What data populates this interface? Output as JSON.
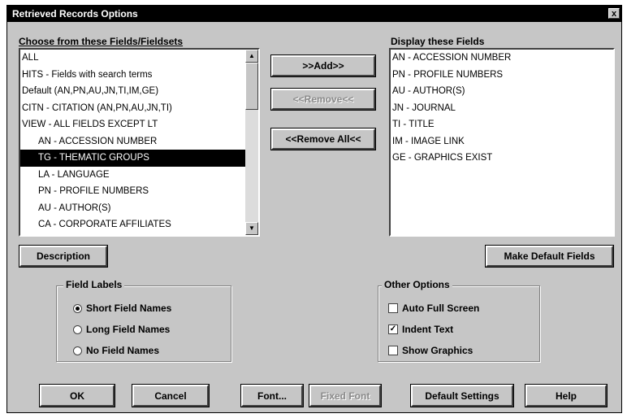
{
  "window": {
    "title": "Retrieved Records Options",
    "close_glyph": "x"
  },
  "choose": {
    "label": "Choose from these Fields/Fieldsets",
    "items": [
      {
        "text": "ALL",
        "indent": false,
        "selected": false
      },
      {
        "text": "HITS - Fields with search terms",
        "indent": false,
        "selected": false
      },
      {
        "text": "Default (AN,PN,AU,JN,TI,IM,GE)",
        "indent": false,
        "selected": false
      },
      {
        "text": "CITN - CITATION (AN,PN,AU,JN,TI)",
        "indent": false,
        "selected": false
      },
      {
        "text": "VIEW - ALL FIELDS EXCEPT LT",
        "indent": false,
        "selected": false
      },
      {
        "text": "AN - ACCESSION NUMBER",
        "indent": true,
        "selected": false
      },
      {
        "text": "TG - THEMATIC GROUPS",
        "indent": true,
        "selected": true
      },
      {
        "text": "LA - LANGUAGE",
        "indent": true,
        "selected": false
      },
      {
        "text": "PN - PROFILE NUMBERS",
        "indent": true,
        "selected": false
      },
      {
        "text": "AU - AUTHOR(S)",
        "indent": true,
        "selected": false
      },
      {
        "text": "CA - CORPORATE AFFILIATES",
        "indent": true,
        "selected": false
      }
    ]
  },
  "display": {
    "label": "Display these Fields",
    "items": [
      "AN - ACCESSION NUMBER",
      "PN - PROFILE NUMBERS",
      "AU - AUTHOR(S)",
      "JN - JOURNAL",
      "TI - TITLE",
      "IM - IMAGE LINK",
      "GE - GRAPHICS EXIST"
    ]
  },
  "buttons": {
    "add": ">>Add>>",
    "remove": "<<Remove<<",
    "remove_all": "<<Remove All<<",
    "description": "Description",
    "make_default": "Make Default Fields",
    "ok": "OK",
    "cancel": "Cancel",
    "font": "Font...",
    "fixed_font": "Fixed Font",
    "default_settings": "Default Settings",
    "help": "Help"
  },
  "field_labels": {
    "title": "Field Labels",
    "options": [
      {
        "label": "Short Field Names",
        "checked": true
      },
      {
        "label": "Long Field Names",
        "checked": false
      },
      {
        "label": "No Field Names",
        "checked": false
      }
    ]
  },
  "other_options": {
    "title": "Other Options",
    "options": [
      {
        "label": "Auto Full Screen",
        "checked": false
      },
      {
        "label": "Indent Text",
        "checked": true
      },
      {
        "label": "Show Graphics",
        "checked": false
      }
    ]
  },
  "icons": {
    "scroll_up": "up-arrow-icon",
    "scroll_down": "down-arrow-icon"
  },
  "colors": {
    "face": "#c6c6c6",
    "selection": "#000000",
    "titlebar": "#000000"
  }
}
